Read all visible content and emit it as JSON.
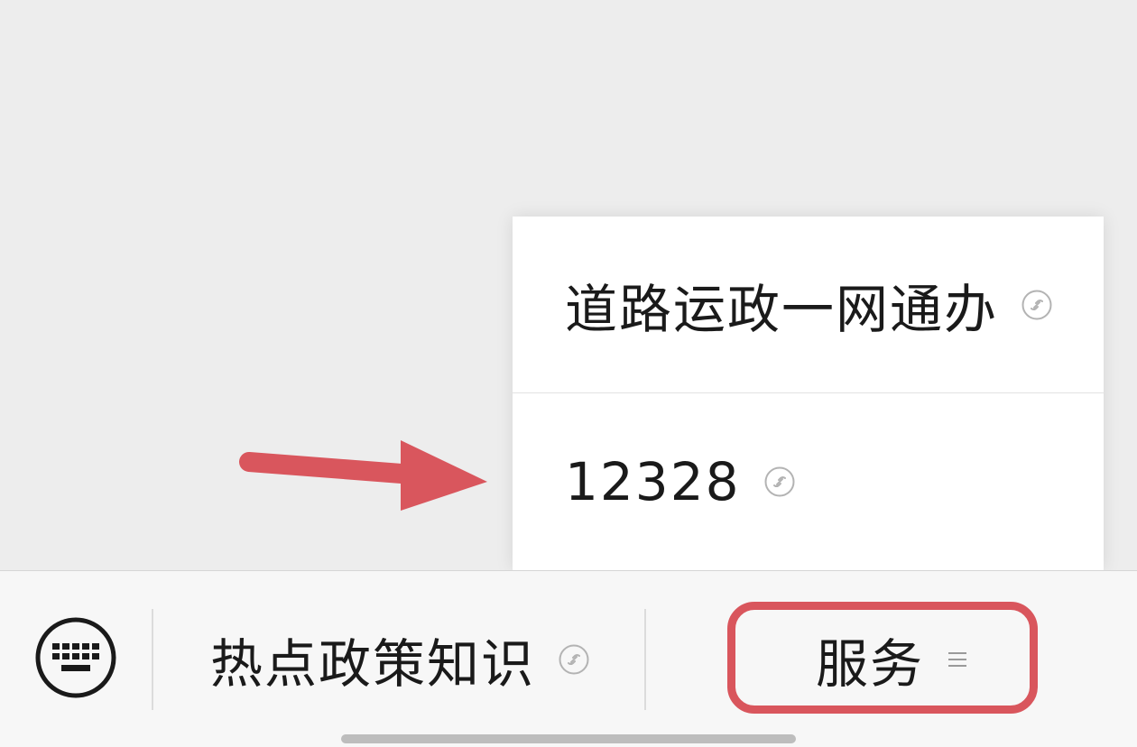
{
  "submenu": {
    "items": [
      {
        "label": "道路运政一网通办",
        "icon": "mini-program-link-icon"
      },
      {
        "label": "12328",
        "icon": "mini-program-link-icon"
      }
    ]
  },
  "menu_bar": {
    "keyboard_icon": "keyboard-icon",
    "items": [
      {
        "label": "热点政策知识",
        "icon": "mini-program-link-icon"
      },
      {
        "label": "服务",
        "icon": "submenu-list-icon"
      }
    ]
  },
  "colors": {
    "annotation": "#d9565d",
    "background": "#ededed",
    "menu_bar": "#f7f7f7"
  }
}
